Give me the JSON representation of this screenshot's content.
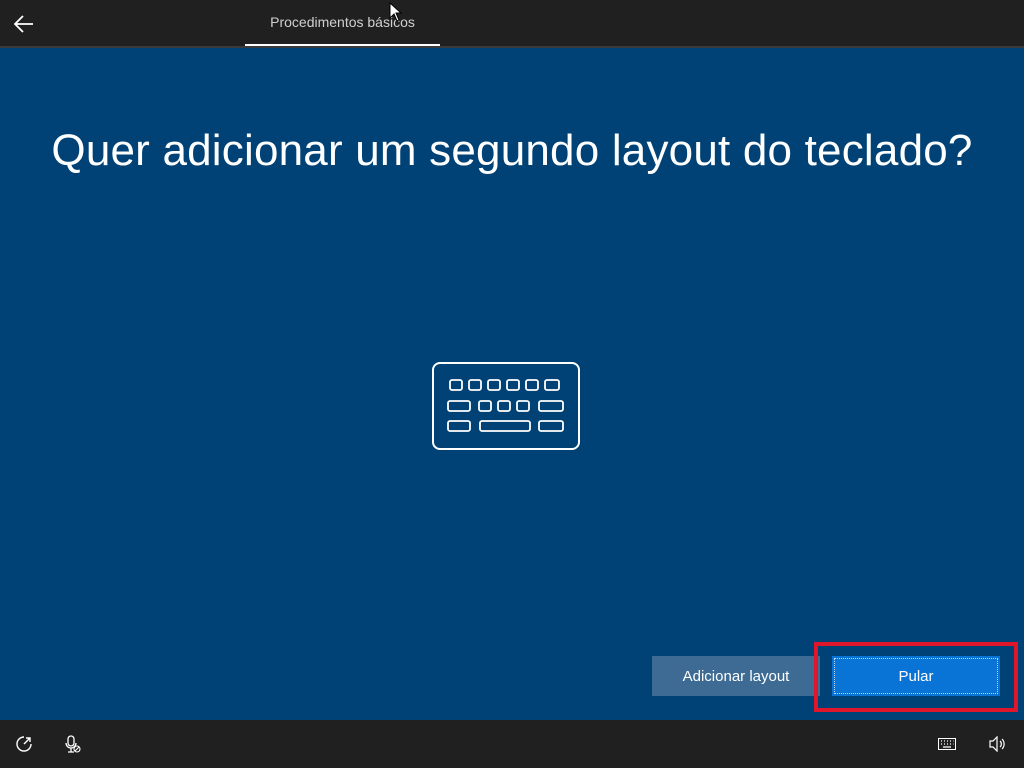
{
  "header": {
    "tab_label": "Procedimentos básicos"
  },
  "main": {
    "title": "Quer adicionar um segundo layout do teclado?",
    "illustration": "keyboard-icon"
  },
  "actions": {
    "secondary_label": "Adicionar layout",
    "primary_label": "Pular"
  },
  "footer": {
    "left_icons": [
      "ease-of-access-icon",
      "microphone-icon"
    ],
    "right_icons": [
      "keyboard-icon",
      "volume-icon"
    ]
  },
  "colors": {
    "background": "#004275",
    "bar": "#202020",
    "primary_button": "#0a74d6",
    "secondary_button": "#3d6b94",
    "highlight": "#e0162b"
  }
}
